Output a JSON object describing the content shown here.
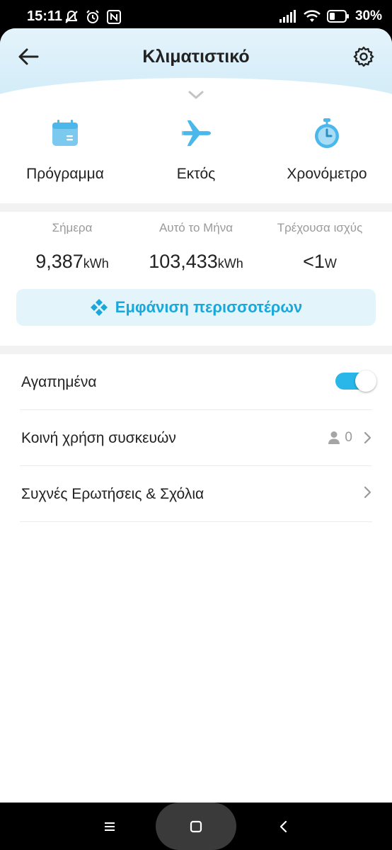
{
  "status_bar": {
    "time": "15:11",
    "battery": "30%"
  },
  "header": {
    "title": "Κλιματιστικό"
  },
  "quick_actions": [
    {
      "label": "Πρόγραμμα",
      "icon": "calendar-icon"
    },
    {
      "label": "Εκτός",
      "icon": "airplane-icon"
    },
    {
      "label": "Χρονόμετρο",
      "icon": "stopwatch-icon"
    }
  ],
  "energy": {
    "today": {
      "caption": "Σήμερα",
      "value": "9,387",
      "unit": "kWh"
    },
    "month": {
      "caption": "Αυτό το Μήνα",
      "value": "103,433",
      "unit": "kWh"
    },
    "power": {
      "caption": "Τρέχουσα ισχύς",
      "value": "<1",
      "unit": "W"
    },
    "more_label": "Εμφάνιση περισσοτέρων"
  },
  "settings": {
    "favorites": {
      "label": "Αγαπημένα",
      "enabled": true
    },
    "sharing": {
      "label": "Κοινή χρήση συσκευών",
      "count": "0"
    },
    "faq": {
      "label": "Συχνές Ερωτήσεις & Σχόλια"
    }
  },
  "colors": {
    "accent": "#29b6e8",
    "accent_text": "#1aa7d9",
    "header_bg": "#d8eef9",
    "icon_blue": "#4cb7ea"
  }
}
